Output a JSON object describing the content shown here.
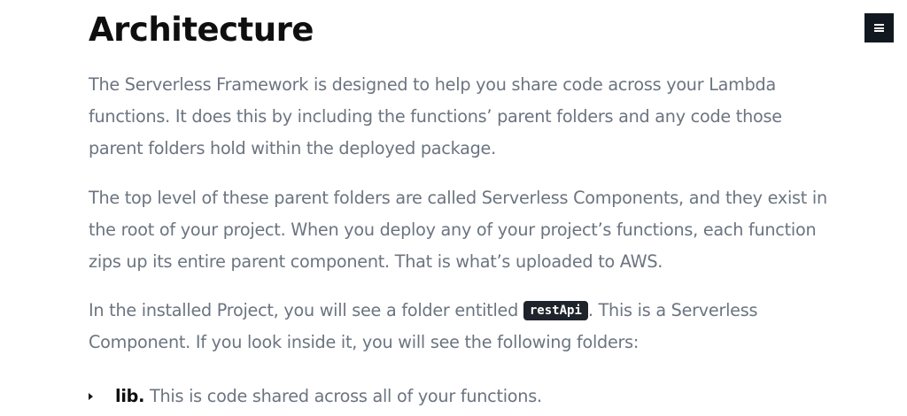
{
  "article": {
    "title": "Architecture",
    "paragraphs": [
      {
        "lines": [
          "The Serverless Framework is designed to help you share code across your Lambda",
          "functions. It does this by including the functions’ parent folders and any code those",
          "parent folders hold within the deployed package."
        ]
      },
      {
        "lines": [
          "The top level of these parent folders are called Serverless Components, and they exist in",
          "the root of your project. When you deploy any of your project’s functions, each function",
          "zips up its entire parent component. That is what’s uploaded to AWS."
        ]
      },
      {
        "line1_before": "In the installed Project, you will see a folder entitled ",
        "code": "restApi",
        "line1_after": ". This is a Serverless",
        "line2": "Component. If you look inside it, you will see the following folders:"
      }
    ],
    "list": [
      {
        "term": "lib.",
        "text": " This is code shared across all of your functions."
      }
    ]
  },
  "menu": {
    "icon": "hamburger-menu-icon"
  },
  "colors": {
    "heading": "#0f0f0f",
    "body_text": "#6b7480",
    "code_background": "#1f232b",
    "menu_button_background": "#111820"
  }
}
